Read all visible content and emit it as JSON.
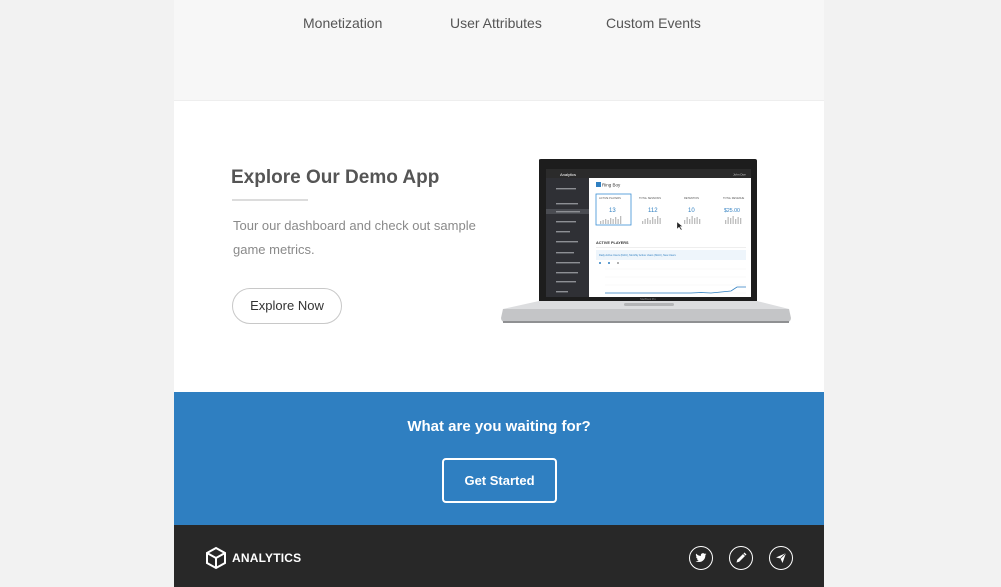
{
  "features": {
    "items": [
      "Monetization",
      "User Attributes",
      "Custom Events"
    ]
  },
  "demo": {
    "title": "Explore Our Demo App",
    "description": "Tour our dashboard and check out sample game metrics.",
    "button_label": "Explore Now",
    "laptop_screen": {
      "brand": "Analytics",
      "user": "John Doe",
      "game_name": "Ring Boy",
      "section": "ACTIVE PLAYERS",
      "cards": [
        {
          "label": "ACTIVE PLAYERS",
          "value": "13"
        },
        {
          "label": "TOTAL SESSIONS",
          "value": "112"
        },
        {
          "label": "RETENTION",
          "value": "10"
        },
        {
          "label": "TOTAL REVENUE",
          "value": "$25.00"
        }
      ],
      "chart_caption": "Daily Active Users (DAU), Monthly Active Users (MAU), New Users",
      "footer_label": "MacBook Pro"
    }
  },
  "cta": {
    "title": "What are you waiting for?",
    "button_label": "Get Started"
  },
  "footer": {
    "logo_text": "ANALYTICS",
    "social_icons": [
      "twitter-icon",
      "pencil-icon",
      "send-icon"
    ]
  },
  "colors": {
    "cta_background": "#2f7fc1",
    "footer_background": "#282828",
    "page_background": "#f2f2f2"
  }
}
